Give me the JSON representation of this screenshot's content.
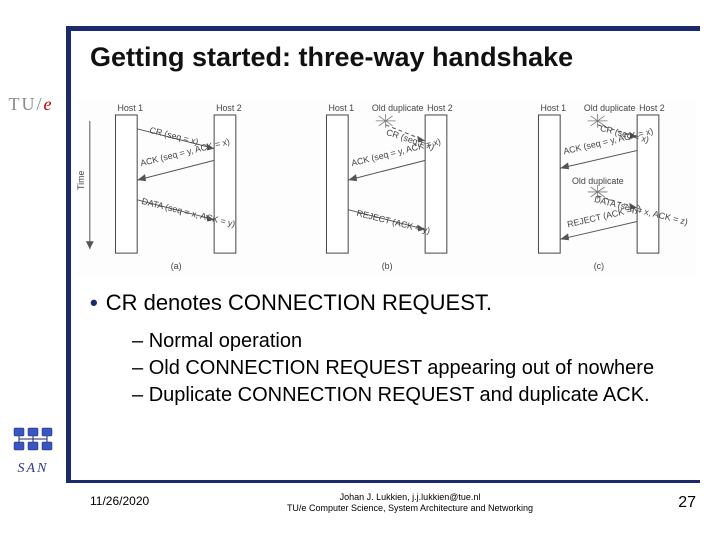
{
  "brand": {
    "text": "TU/",
    "accent": "e"
  },
  "title": "Getting started: three-way handshake",
  "figure": {
    "hosts": [
      "Host 1",
      "Host 2"
    ],
    "time_label": "Time",
    "old_dup": "Old duplicate",
    "panels": {
      "a": {
        "label": "(a)",
        "msgs": [
          "CR (seq = x)",
          "ACK (seq = y, ACK = x)",
          "DATA (seq = x, ACK = y)"
        ]
      },
      "b": {
        "label": "(b)",
        "msgs": [
          "CR (seq = x)",
          "ACK (seq = y, ACK = x)",
          "REJECT (ACK = y)"
        ]
      },
      "c": {
        "label": "(c)",
        "msgs": [
          "CR (seq = x)",
          "ACK (seq = y, ACK = x)",
          "DATA (seq = x, ACK = z)",
          "REJECT (ACK = y)"
        ]
      }
    }
  },
  "body": {
    "l1": "CR denotes CONNECTION REQUEST.",
    "sub": {
      "a": "Normal operation",
      "b": "Old CONNECTION REQUEST appearing out of nowhere",
      "c": "Duplicate CONNECTION REQUEST and duplicate ACK."
    }
  },
  "san": "SAN",
  "footer": {
    "date": "11/26/2020",
    "line1": "Johan J. Lukkien, j.j.lukkien@tue.nl",
    "line2": "TU/e Computer Science, System Architecture and Networking",
    "page": "27"
  }
}
